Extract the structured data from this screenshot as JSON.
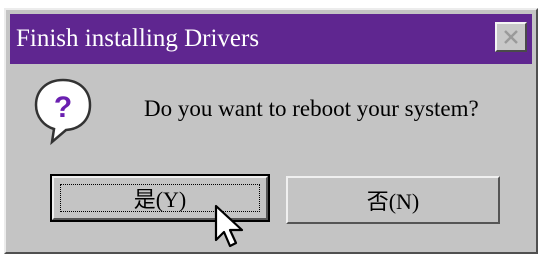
{
  "window": {
    "title": "Finish installing Drivers",
    "titlebar_color": "#5f2690",
    "close_icon": "close-icon"
  },
  "dialog": {
    "icon": "question-icon",
    "message": "Do you want to reboot your system?"
  },
  "buttons": {
    "yes_label": "是(Y)",
    "no_label": "否(N)"
  }
}
